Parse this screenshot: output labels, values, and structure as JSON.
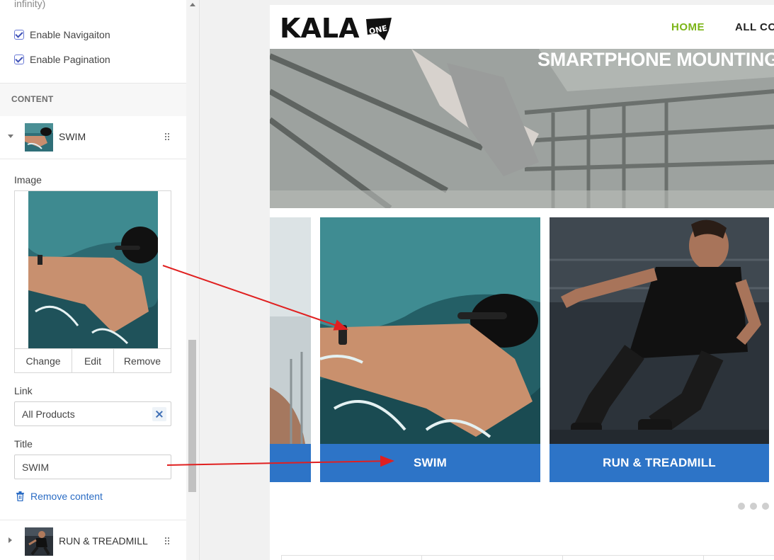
{
  "panel": {
    "infinity_note": "infinity)",
    "checkboxes": [
      {
        "label": "Enable Navigaiton",
        "checked": true
      },
      {
        "label": "Enable Pagination",
        "checked": true
      }
    ],
    "section_title": "CONTENT",
    "items": [
      {
        "title": "SWIM",
        "expanded": true
      },
      {
        "title": "RUN & TREADMILL",
        "expanded": false
      }
    ],
    "image_label": "Image",
    "image_actions": [
      "Change",
      "Edit",
      "Remove"
    ],
    "link_label": "Link",
    "link_value": "All Products",
    "title_label": "Title",
    "title_value": "SWIM",
    "remove_content": "Remove content"
  },
  "preview": {
    "logo_text": "KALA",
    "logo_badge": "ONE",
    "nav": [
      "HOME",
      "ALL CO"
    ],
    "hero_title": "SMARTPHONE MOUNTING",
    "slides": [
      {
        "caption": ""
      },
      {
        "caption": "SWIM"
      },
      {
        "caption": "RUN & TREADMILL"
      }
    ],
    "pagination_dots": 3
  },
  "colors": {
    "nav_active": "#7cb518",
    "caption_bg": "#2d74c7",
    "link_blue": "#2b6cc4",
    "arrow_red": "#e02020"
  }
}
